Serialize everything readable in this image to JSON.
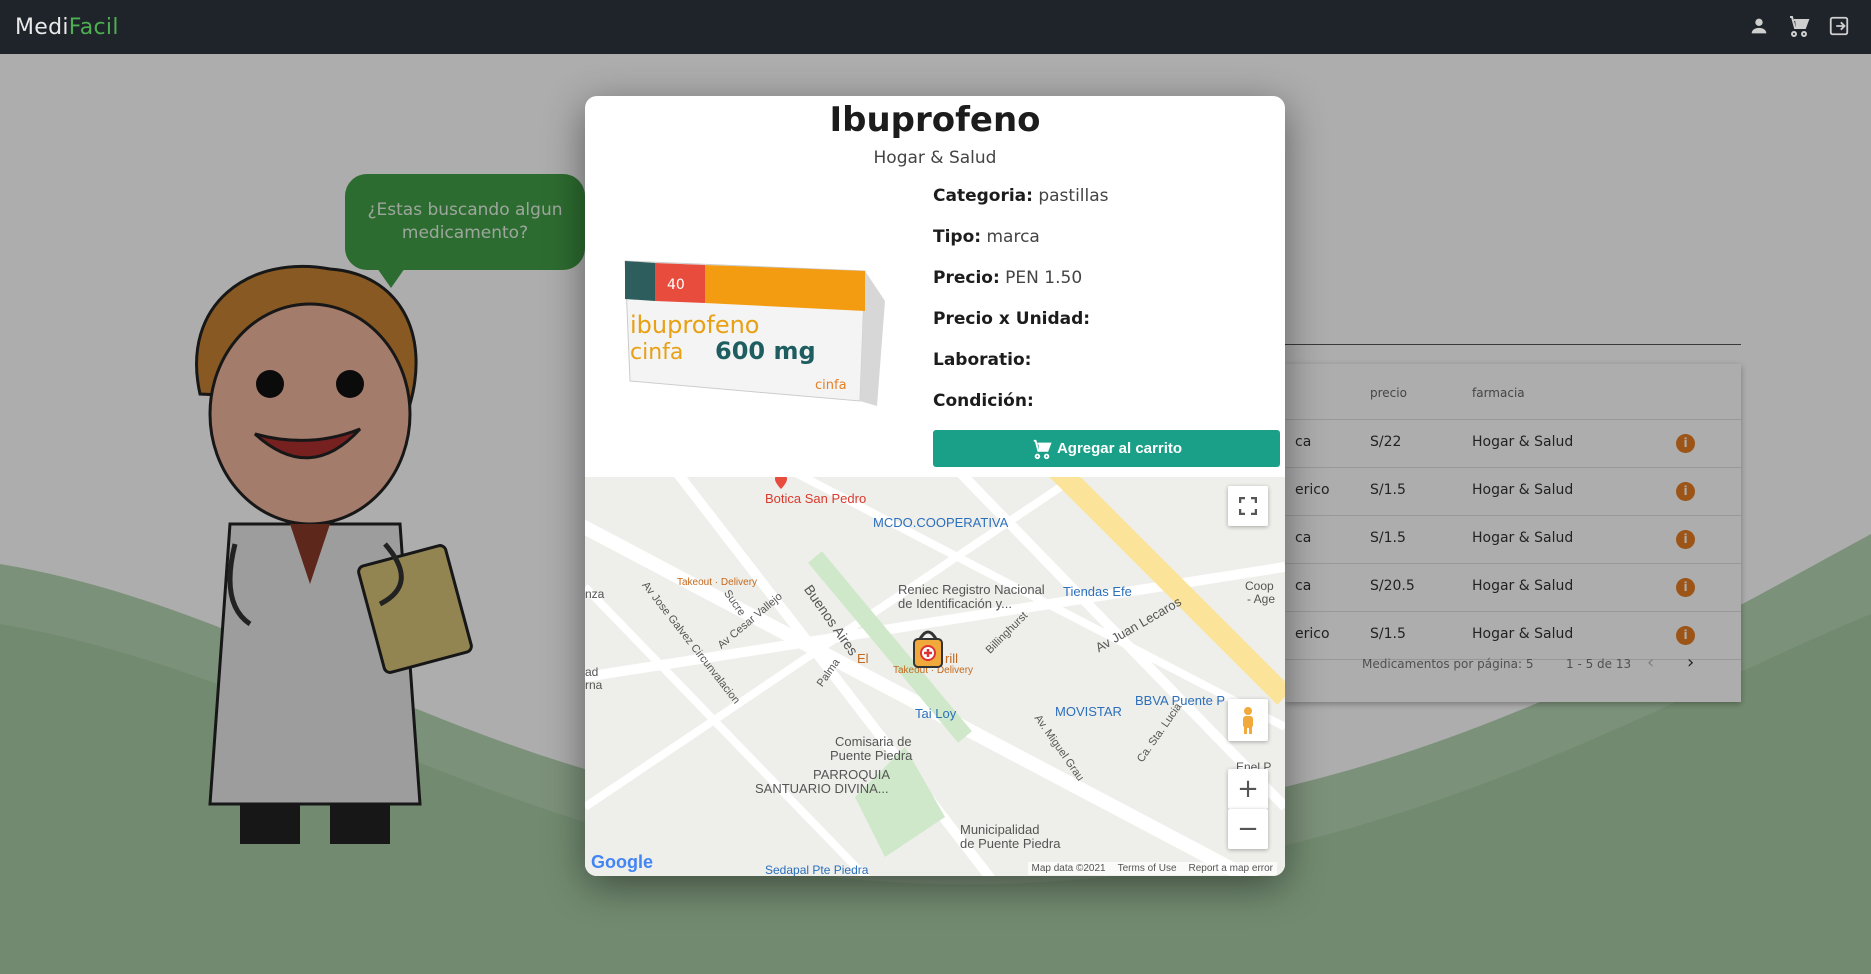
{
  "app": {
    "brand_part1": "Medi",
    "brand_part2": "Facil"
  },
  "header": {
    "icons": [
      "account-icon",
      "cart-icon",
      "logout-icon"
    ]
  },
  "background": {
    "bubble_text": "¿Estas buscando algun medicamento?",
    "table": {
      "columns": [
        "precio",
        "farmacia"
      ],
      "rows": [
        {
          "tipo_partial": "ca",
          "precio": "S/22",
          "farmacia": "Hogar & Salud"
        },
        {
          "tipo_partial": "erico",
          "precio": "S/1.5",
          "farmacia": "Hogar & Salud"
        },
        {
          "tipo_partial": "ca",
          "precio": "S/1.5",
          "farmacia": "Hogar & Salud"
        },
        {
          "tipo_partial": "ca",
          "precio": "S/20.5",
          "farmacia": "Hogar & Salud"
        },
        {
          "tipo_partial": "erico",
          "precio": "S/1.5",
          "farmacia": "Hogar & Salud"
        }
      ],
      "footer": {
        "per_page_label": "Medicamentos por página: 5",
        "range": "1 - 5 de 13"
      }
    }
  },
  "modal": {
    "title": "Ibuprofeno",
    "pharmacy": "Hogar & Salud",
    "product_image_text": {
      "count": "40",
      "name_line1": "ibuprofeno",
      "name_line2": "cinfa",
      "dose": "600 mg",
      "brand": "cinfa"
    },
    "details": [
      {
        "label": "Categoria:",
        "value": "pastillas"
      },
      {
        "label": "Tipo:",
        "value": "marca"
      },
      {
        "label": "Precio:",
        "value": "PEN 1.50"
      },
      {
        "label": "Precio x Unidad:",
        "value": ""
      },
      {
        "label": "Laboratio:",
        "value": ""
      },
      {
        "label": "Condición:",
        "value": ""
      }
    ],
    "add_to_cart_label": "Agregar al carrito",
    "map": {
      "labels": [
        "Botica San Pedro",
        "MCDO.COOPERATIVA",
        "Takeout · Delivery",
        "Reniec Registro Nacional",
        "de Identificación y...",
        "Tiendas Efe",
        "Coop",
        "- Age",
        "Buenos Aires",
        "Sucre",
        "Av Cesar Vallejo",
        "Av Jose Galvez Circunvalacion",
        "Palma",
        "El",
        "rill",
        "Takeout · Delivery",
        "Billinghurst",
        "Av Juan Lecaros",
        "BBVA Puente P",
        "Tai Loy",
        "MOVISTAR",
        "Comisaria de",
        "Puente Piedra",
        "PARROQUIA",
        "SANTUARIO DIVINA...",
        "Av. Miguel Grau",
        "Ca. Sta. Lucia",
        "Municipalidad",
        "de Puente Piedra",
        "Enel P",
        "Sedapal Pte Piedra",
        "nza",
        "ad",
        "rna"
      ],
      "footer": {
        "data": "Map data ©2021",
        "terms": "Terms of Use",
        "report": "Report a map error"
      },
      "logo": "Google"
    }
  }
}
